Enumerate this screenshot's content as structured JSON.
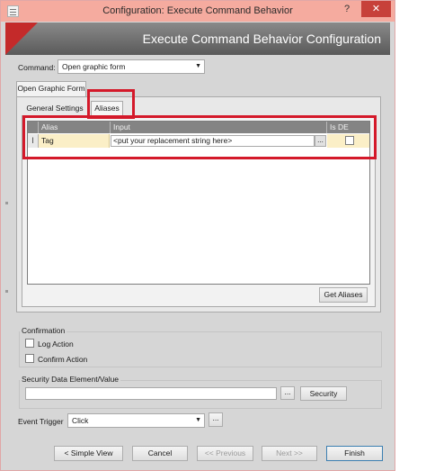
{
  "window": {
    "title": "Configuration: Execute Command Behavior",
    "help_glyph": "?",
    "close_glyph": "✕"
  },
  "banner": {
    "title": "Execute Command Behavior Configuration"
  },
  "command": {
    "label": "Command:",
    "value": "Open graphic form"
  },
  "outer_tab": {
    "label": "Open Graphic Form"
  },
  "inner_tabs": [
    {
      "label": "General Settings",
      "selected": false
    },
    {
      "label": "Aliases",
      "selected": true
    }
  ],
  "grid": {
    "columns": [
      "Alias",
      "Input",
      "Is DE"
    ],
    "rows": [
      {
        "alias": "Tag",
        "input": "<put your replacement string here>",
        "is_de": false,
        "row_icon": "I"
      }
    ]
  },
  "get_aliases_button": "Get Aliases",
  "confirmation": {
    "title": "Confirmation",
    "log_action": {
      "label": "Log Action",
      "checked": false
    },
    "confirm_action": {
      "label": "Confirm Action",
      "checked": false
    }
  },
  "security": {
    "title": "Security Data Element/Value",
    "value": "",
    "browse_label": "...",
    "button_label": "Security"
  },
  "event_trigger": {
    "label": "Event Trigger",
    "value": "Click",
    "browse_label": "..."
  },
  "footer": {
    "simple_view": "< Simple View",
    "cancel": "Cancel",
    "previous": "<< Previous",
    "next": "Next >>",
    "finish": "Finish"
  },
  "colors": {
    "titlebar": "#f5ab9f",
    "close_button": "#c7413a",
    "banner_accent": "#c42a2a",
    "highlight": "#d4192a",
    "row_highlight": "#fbefc7"
  }
}
